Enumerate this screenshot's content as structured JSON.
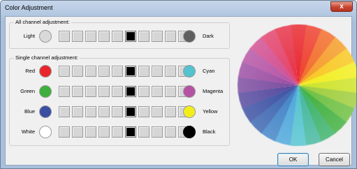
{
  "window": {
    "title": "Color Adjustment",
    "close_glyph": "x"
  },
  "all_channel": {
    "label": "All channel adjustment:",
    "left": {
      "label": "Light",
      "color": "#d9d9d9"
    },
    "right": {
      "label": "Dark",
      "color": "#5f5f5f"
    },
    "level": 5
  },
  "single_channel": {
    "label": "Single channel adjustment:",
    "rows": [
      {
        "left_label": "Red",
        "left_color": "#e8252b",
        "right_label": "Cyan",
        "right_color": "#52c3cf",
        "level": 5
      },
      {
        "left_label": "Green",
        "left_color": "#3eaf3c",
        "right_label": "Magenta",
        "right_color": "#b552a4",
        "level": 5
      },
      {
        "left_label": "Blue",
        "left_color": "#3a4fa2",
        "right_label": "Yellow",
        "right_color": "#f2ee1c",
        "level": 5
      },
      {
        "left_label": "White",
        "left_color": "#ffffff",
        "right_label": "Black",
        "right_color": "#000000",
        "level": 5
      }
    ]
  },
  "slider_steps": 10,
  "wheel_colors": [
    "#e8252b",
    "#ee3d2a",
    "#f26b27",
    "#f59b24",
    "#f8c71d",
    "#f2ee1c",
    "#cde327",
    "#9ecd3a",
    "#6cbf3f",
    "#3eaf3c",
    "#3ab169",
    "#43b79e",
    "#52c3cf",
    "#4ba6da",
    "#3f82c6",
    "#3a64b0",
    "#3a4fa2",
    "#54479d",
    "#7a4a9f",
    "#9b4ca2",
    "#b552a4",
    "#d14b8f",
    "#e23f6a",
    "#e62f45"
  ],
  "buttons": {
    "ok": "OK",
    "cancel": "Cancel"
  }
}
